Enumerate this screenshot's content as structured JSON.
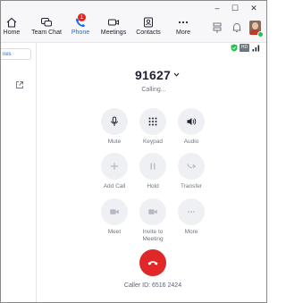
{
  "window": {
    "minimize_glyph": "–",
    "maximize_glyph": "☐",
    "close_glyph": "✕"
  },
  "nav": {
    "items": [
      {
        "label": "Home",
        "icon": "home-icon"
      },
      {
        "label": "Team Chat",
        "icon": "chat-icon"
      },
      {
        "label": "Phone",
        "icon": "phone-icon",
        "badge": "1",
        "active": true
      },
      {
        "label": "Meetings",
        "icon": "video-icon"
      },
      {
        "label": "Contacts",
        "icon": "contacts-icon"
      },
      {
        "label": "More",
        "icon": "more-icon"
      }
    ]
  },
  "sidebar": {
    "tab_label": "nes"
  },
  "status": {
    "shield_color": "#2cbe4e",
    "hd_label": "HD"
  },
  "call": {
    "callee": "91627",
    "status": "Calling...",
    "controls": [
      {
        "label": "Mute",
        "icon": "microphone-icon",
        "enabled": true
      },
      {
        "label": "Keypad",
        "icon": "keypad-icon",
        "enabled": true
      },
      {
        "label": "Audio",
        "icon": "speaker-icon",
        "enabled": true
      },
      {
        "label": "Add Call",
        "icon": "plus-icon",
        "enabled": false
      },
      {
        "label": "Hold",
        "icon": "pause-icon",
        "enabled": false
      },
      {
        "label": "Transfer",
        "icon": "transfer-icon",
        "enabled": false
      },
      {
        "label": "Meet",
        "icon": "video-camera-icon",
        "enabled": false
      },
      {
        "label": "Invite to Meeting",
        "label_line1": "Invite to",
        "label_line2": "Meeting",
        "icon": "invite-video-icon",
        "enabled": false
      },
      {
        "label": "More",
        "icon": "more-dots-icon",
        "enabled": false
      }
    ],
    "hangup_color": "#e02828",
    "caller_id": "Caller ID: 6516 2424"
  },
  "colors": {
    "accent": "#0e71eb",
    "badge": "#e02828"
  }
}
